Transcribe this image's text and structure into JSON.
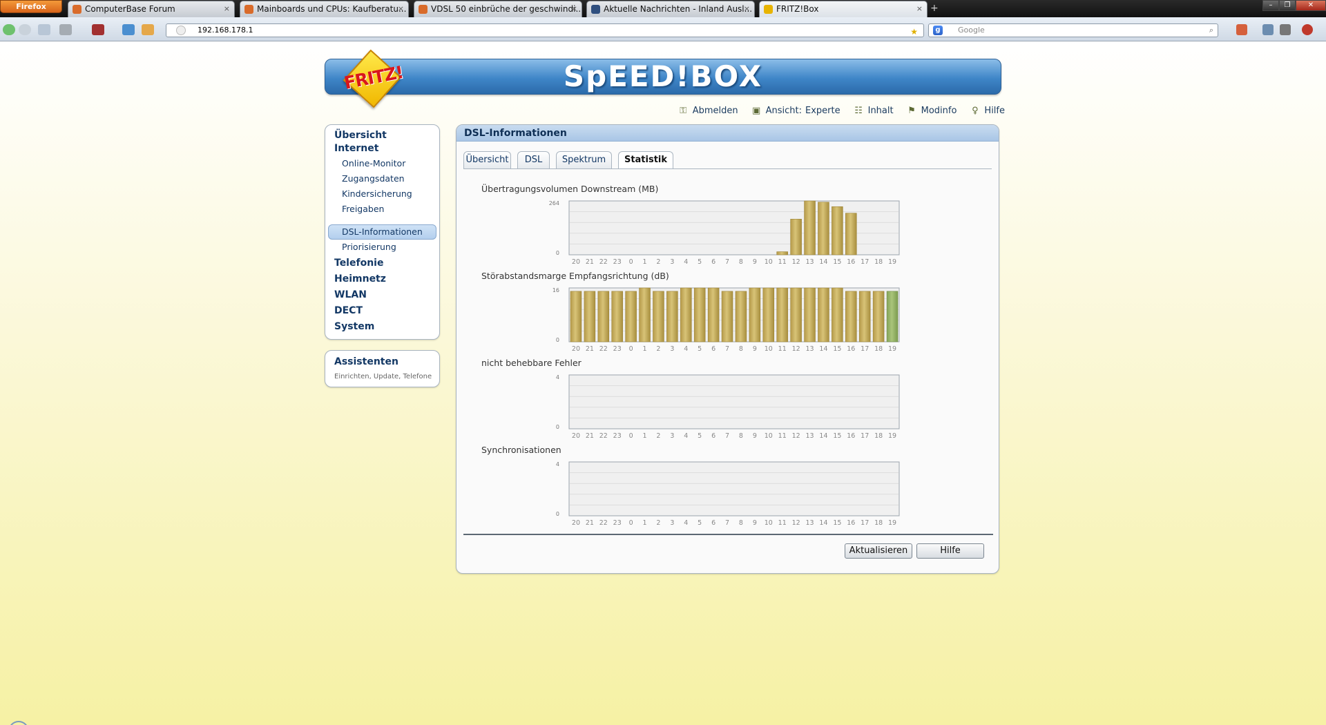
{
  "browser": {
    "menu_button": "Firefox",
    "tabs": [
      {
        "title": "ComputerBase Forum"
      },
      {
        "title": "Mainboards und CPUs: Kaufberatu..."
      },
      {
        "title": "VDSL 50 einbrüche der geschwindi..."
      },
      {
        "title": "Aktuelle Nachrichten - Inland Ausl..."
      },
      {
        "title": "FRITZ!Box"
      }
    ],
    "url": "192.168.178.1",
    "search_placeholder": "Google",
    "search_engine_letter": "g",
    "new_tab": "+",
    "close_glyph": "×"
  },
  "header": {
    "logo_text": "FRITZ!",
    "title": "SpEED!BOX"
  },
  "toplinks": {
    "logout": "Abmelden",
    "view_label": "Ansicht:",
    "view_value": "Experte",
    "contents": "Inhalt",
    "modinfo": "Modinfo",
    "help": "Hilfe"
  },
  "sidebar": {
    "overview": "Übersicht",
    "internet": "Internet",
    "internet_items": [
      "Online-Monitor",
      "Zugangsdaten",
      "Kindersicherung",
      "Freigaben",
      "DSL-Informationen",
      "Priorisierung"
    ],
    "selected_index": 4,
    "sections": [
      "Telefonie",
      "Heimnetz",
      "WLAN",
      "DECT",
      "System"
    ]
  },
  "assistants": {
    "title": "Assistenten",
    "subtitle": "Einrichten, Update, Telefone"
  },
  "main": {
    "title": "DSL-Informationen",
    "tabs": [
      "Übersicht",
      "DSL",
      "Spektrum",
      "Statistik"
    ],
    "active_tab": 3,
    "buttons": {
      "refresh": "Aktualisieren",
      "help": "Hilfe"
    }
  },
  "chart_data": [
    {
      "type": "bar",
      "title": "Übertragungsvolumen Downstream (MB)",
      "categories": [
        "20",
        "21",
        "22",
        "23",
        "0",
        "1",
        "2",
        "3",
        "4",
        "5",
        "6",
        "7",
        "8",
        "9",
        "10",
        "11",
        "12",
        "13",
        "14",
        "15",
        "16",
        "17",
        "18",
        "19"
      ],
      "values": [
        0,
        0,
        0,
        0,
        0,
        0,
        0,
        0,
        0,
        0,
        0,
        0,
        0,
        0,
        0,
        15,
        175,
        264,
        258,
        236,
        204,
        0,
        0,
        0
      ],
      "ylim": [
        0,
        264
      ],
      "yticks": [
        "0",
        "264"
      ],
      "grid": true
    },
    {
      "type": "bar",
      "title": "Störabstandsmarge Empfangsrichtung (dB)",
      "categories": [
        "20",
        "21",
        "22",
        "23",
        "0",
        "1",
        "2",
        "3",
        "4",
        "5",
        "6",
        "7",
        "8",
        "9",
        "10",
        "11",
        "12",
        "13",
        "14",
        "15",
        "16",
        "17",
        "18",
        "19"
      ],
      "values": [
        15,
        15,
        15,
        15,
        15,
        16,
        15,
        15,
        16,
        16,
        16,
        15,
        15,
        16,
        16,
        16,
        16,
        16,
        16,
        16,
        15,
        15,
        15,
        15
      ],
      "highlight_last": true,
      "ylim": [
        0,
        16
      ],
      "yticks": [
        "0",
        "16"
      ],
      "grid": true
    },
    {
      "type": "bar",
      "title": "nicht behebbare Fehler",
      "categories": [
        "20",
        "21",
        "22",
        "23",
        "0",
        "1",
        "2",
        "3",
        "4",
        "5",
        "6",
        "7",
        "8",
        "9",
        "10",
        "11",
        "12",
        "13",
        "14",
        "15",
        "16",
        "17",
        "18",
        "19"
      ],
      "values": [
        0,
        0,
        0,
        0,
        0,
        0,
        0,
        0,
        0,
        0,
        0,
        0,
        0,
        0,
        0,
        0,
        0,
        0,
        0,
        0,
        0,
        0,
        0,
        0
      ],
      "ylim": [
        0,
        4
      ],
      "yticks": [
        "0",
        "4"
      ],
      "grid": true
    },
    {
      "type": "bar",
      "title": "Synchronisationen",
      "categories": [
        "20",
        "21",
        "22",
        "23",
        "0",
        "1",
        "2",
        "3",
        "4",
        "5",
        "6",
        "7",
        "8",
        "9",
        "10",
        "11",
        "12",
        "13",
        "14",
        "15",
        "16",
        "17",
        "18",
        "19"
      ],
      "values": [
        0,
        0,
        0,
        0,
        0,
        0,
        0,
        0,
        0,
        0,
        0,
        0,
        0,
        0,
        0,
        0,
        0,
        0,
        0,
        0,
        0,
        0,
        0,
        0
      ],
      "ylim": [
        0,
        4
      ],
      "yticks": [
        "0",
        "4"
      ],
      "grid": true
    }
  ],
  "colors": {
    "bar": "#d8c377",
    "bar_highlight": "#a9c47a",
    "header_blue": "#3f86c8",
    "nav_text": "#133865"
  }
}
